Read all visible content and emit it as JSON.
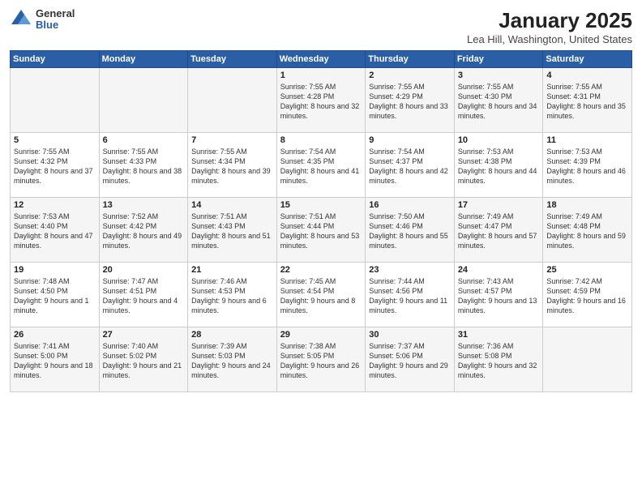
{
  "header": {
    "logo_general": "General",
    "logo_blue": "Blue",
    "title": "January 2025",
    "subtitle": "Lea Hill, Washington, United States"
  },
  "calendar": {
    "days_of_week": [
      "Sunday",
      "Monday",
      "Tuesday",
      "Wednesday",
      "Thursday",
      "Friday",
      "Saturday"
    ],
    "weeks": [
      [
        {
          "day": "",
          "info": ""
        },
        {
          "day": "",
          "info": ""
        },
        {
          "day": "",
          "info": ""
        },
        {
          "day": "1",
          "info": "Sunrise: 7:55 AM\nSunset: 4:28 PM\nDaylight: 8 hours and 32 minutes."
        },
        {
          "day": "2",
          "info": "Sunrise: 7:55 AM\nSunset: 4:29 PM\nDaylight: 8 hours and 33 minutes."
        },
        {
          "day": "3",
          "info": "Sunrise: 7:55 AM\nSunset: 4:30 PM\nDaylight: 8 hours and 34 minutes."
        },
        {
          "day": "4",
          "info": "Sunrise: 7:55 AM\nSunset: 4:31 PM\nDaylight: 8 hours and 35 minutes."
        }
      ],
      [
        {
          "day": "5",
          "info": "Sunrise: 7:55 AM\nSunset: 4:32 PM\nDaylight: 8 hours and 37 minutes."
        },
        {
          "day": "6",
          "info": "Sunrise: 7:55 AM\nSunset: 4:33 PM\nDaylight: 8 hours and 38 minutes."
        },
        {
          "day": "7",
          "info": "Sunrise: 7:55 AM\nSunset: 4:34 PM\nDaylight: 8 hours and 39 minutes."
        },
        {
          "day": "8",
          "info": "Sunrise: 7:54 AM\nSunset: 4:35 PM\nDaylight: 8 hours and 41 minutes."
        },
        {
          "day": "9",
          "info": "Sunrise: 7:54 AM\nSunset: 4:37 PM\nDaylight: 8 hours and 42 minutes."
        },
        {
          "day": "10",
          "info": "Sunrise: 7:53 AM\nSunset: 4:38 PM\nDaylight: 8 hours and 44 minutes."
        },
        {
          "day": "11",
          "info": "Sunrise: 7:53 AM\nSunset: 4:39 PM\nDaylight: 8 hours and 46 minutes."
        }
      ],
      [
        {
          "day": "12",
          "info": "Sunrise: 7:53 AM\nSunset: 4:40 PM\nDaylight: 8 hours and 47 minutes."
        },
        {
          "day": "13",
          "info": "Sunrise: 7:52 AM\nSunset: 4:42 PM\nDaylight: 8 hours and 49 minutes."
        },
        {
          "day": "14",
          "info": "Sunrise: 7:51 AM\nSunset: 4:43 PM\nDaylight: 8 hours and 51 minutes."
        },
        {
          "day": "15",
          "info": "Sunrise: 7:51 AM\nSunset: 4:44 PM\nDaylight: 8 hours and 53 minutes."
        },
        {
          "day": "16",
          "info": "Sunrise: 7:50 AM\nSunset: 4:46 PM\nDaylight: 8 hours and 55 minutes."
        },
        {
          "day": "17",
          "info": "Sunrise: 7:49 AM\nSunset: 4:47 PM\nDaylight: 8 hours and 57 minutes."
        },
        {
          "day": "18",
          "info": "Sunrise: 7:49 AM\nSunset: 4:48 PM\nDaylight: 8 hours and 59 minutes."
        }
      ],
      [
        {
          "day": "19",
          "info": "Sunrise: 7:48 AM\nSunset: 4:50 PM\nDaylight: 9 hours and 1 minute."
        },
        {
          "day": "20",
          "info": "Sunrise: 7:47 AM\nSunset: 4:51 PM\nDaylight: 9 hours and 4 minutes."
        },
        {
          "day": "21",
          "info": "Sunrise: 7:46 AM\nSunset: 4:53 PM\nDaylight: 9 hours and 6 minutes."
        },
        {
          "day": "22",
          "info": "Sunrise: 7:45 AM\nSunset: 4:54 PM\nDaylight: 9 hours and 8 minutes."
        },
        {
          "day": "23",
          "info": "Sunrise: 7:44 AM\nSunset: 4:56 PM\nDaylight: 9 hours and 11 minutes."
        },
        {
          "day": "24",
          "info": "Sunrise: 7:43 AM\nSunset: 4:57 PM\nDaylight: 9 hours and 13 minutes."
        },
        {
          "day": "25",
          "info": "Sunrise: 7:42 AM\nSunset: 4:59 PM\nDaylight: 9 hours and 16 minutes."
        }
      ],
      [
        {
          "day": "26",
          "info": "Sunrise: 7:41 AM\nSunset: 5:00 PM\nDaylight: 9 hours and 18 minutes."
        },
        {
          "day": "27",
          "info": "Sunrise: 7:40 AM\nSunset: 5:02 PM\nDaylight: 9 hours and 21 minutes."
        },
        {
          "day": "28",
          "info": "Sunrise: 7:39 AM\nSunset: 5:03 PM\nDaylight: 9 hours and 24 minutes."
        },
        {
          "day": "29",
          "info": "Sunrise: 7:38 AM\nSunset: 5:05 PM\nDaylight: 9 hours and 26 minutes."
        },
        {
          "day": "30",
          "info": "Sunrise: 7:37 AM\nSunset: 5:06 PM\nDaylight: 9 hours and 29 minutes."
        },
        {
          "day": "31",
          "info": "Sunrise: 7:36 AM\nSunset: 5:08 PM\nDaylight: 9 hours and 32 minutes."
        },
        {
          "day": "",
          "info": ""
        }
      ]
    ]
  }
}
